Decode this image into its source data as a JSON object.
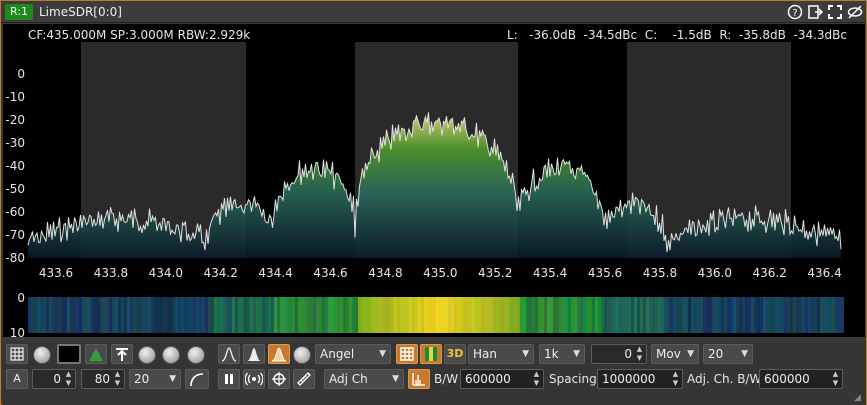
{
  "window": {
    "badge": "R:1",
    "title": "LimeSDR[0:0]"
  },
  "title_icons": [
    "help-icon",
    "detach-icon",
    "maximize-icon",
    "hide-icon"
  ],
  "spectrum": {
    "info_line": "CF:435.000M SP:3.000M RBW:2.929k",
    "readouts": "L:   -36.0dB  -34.5dBc  C:    -1.5dB  R:  -35.8dB  -34.3dBc",
    "y_ticks": [
      "0",
      "-10",
      "-20",
      "-30",
      "-40",
      "-50",
      "-60",
      "-70",
      "-80"
    ],
    "x_ticks": [
      "433.6",
      "433.8",
      "434.0",
      "434.2",
      "434.4",
      "434.6",
      "434.8",
      "435.0",
      "435.2",
      "435.4",
      "435.6",
      "435.8",
      "436.0",
      "436.2",
      "436.4"
    ]
  },
  "waterfall": {
    "y_ticks": [
      "0",
      "10"
    ]
  },
  "controls": {
    "row1": {
      "palette": "Angel",
      "window": "Han",
      "fft_size": "1k",
      "fps_value": "0",
      "avg_mode": "Mov",
      "avg_value": "20",
      "btn_3d": "3D"
    },
    "row2": {
      "auto_label": "A",
      "ref_value": "0",
      "range_value": "80",
      "persist_value": "20",
      "measure_mode": "Adj Ch",
      "bw_label": "B/W",
      "bw_value": "600000",
      "spacing_label": "Spacing",
      "spacing_value": "1000000",
      "adj_bw_label": "Adj. Ch. B/W",
      "adj_bw_value": "600000"
    }
  },
  "colors": {
    "accent": "#c77a2e",
    "badge": "#1e8a1e",
    "trace": "#e0e0e0"
  }
}
